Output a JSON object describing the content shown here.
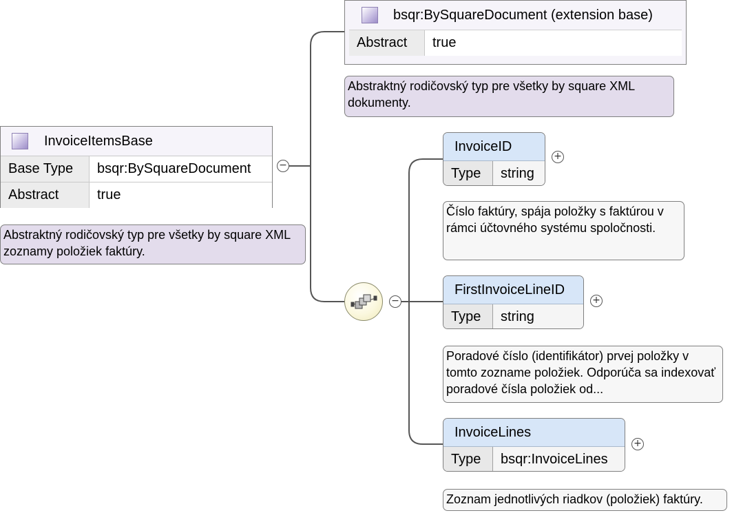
{
  "base_type_box": {
    "title": "bsqr:BySquareDocument (extension base)",
    "rows": [
      {
        "key": "Abstract",
        "value": "true"
      }
    ],
    "note": "Abstraktný rodičovský typ pre všetky by square XML dokumenty."
  },
  "root_type_box": {
    "title": "InvoiceItemsBase",
    "rows": [
      {
        "key": "Base Type",
        "value": "bsqr:BySquareDocument"
      },
      {
        "key": "Abstract",
        "value": "true"
      }
    ],
    "note": "Abstraktný rodičovský typ pre všetky by square XML zoznamy položiek faktúry."
  },
  "elements": [
    {
      "name": "InvoiceID",
      "type_key": "Type",
      "type_value": "string",
      "note": "Číslo faktúry, spája položky s faktúrou v rámci účtovného systému spoločnosti."
    },
    {
      "name": "FirstInvoiceLineID",
      "type_key": "Type",
      "type_value": "string",
      "note": "Poradové číslo (identifikátor) prvej položky v tomto zozname položiek. Odporúča sa indexovať poradové čísla položiek od..."
    },
    {
      "name": "InvoiceLines",
      "type_key": "Type",
      "type_value": "bsqr:InvoiceLines",
      "note": "Zoznam jednotlivých riadkov (položiek) faktúry."
    }
  ],
  "toggles": {
    "collapse": "−",
    "expand": "+"
  },
  "colors": {
    "type_box_bg": "#f6f4fa",
    "element_header_bg": "#d7e6f8",
    "purple_note_bg": "#e3dcec",
    "gray_note_bg": "#f7f7f7",
    "connector": "#555555"
  }
}
